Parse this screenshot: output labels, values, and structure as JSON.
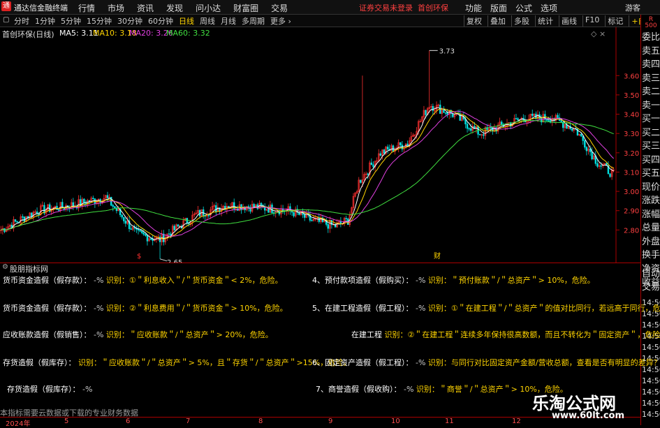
{
  "titlebar": {
    "app_name": "通达信金融终端",
    "menu": [
      "行情",
      "市场",
      "资讯",
      "发现",
      "问小达",
      "财富圈",
      "交易"
    ],
    "notice": "证券交易未登录",
    "stock": "首创环保",
    "right_menu": [
      "功能",
      "版面",
      "公式",
      "选项"
    ],
    "user": "游客"
  },
  "periods": [
    {
      "label": "分时"
    },
    {
      "label": "1分钟"
    },
    {
      "label": "5分钟"
    },
    {
      "label": "15分钟"
    },
    {
      "label": "30分钟"
    },
    {
      "label": "60分钟"
    },
    {
      "label": "日线",
      "active": true
    },
    {
      "label": "周线"
    },
    {
      "label": "月线"
    },
    {
      "label": "多周期"
    },
    {
      "label": "更多 ›"
    }
  ],
  "tools": [
    {
      "label": "复权"
    },
    {
      "label": "叠加"
    },
    {
      "label": "多股"
    },
    {
      "label": "统计"
    },
    {
      "label": "画线"
    },
    {
      "label": "F10"
    },
    {
      "label": "标记"
    },
    {
      "label": "+自选",
      "hl": true
    }
  ],
  "chart_header": {
    "stock_label": "首创环保(日线)",
    "ma": [
      {
        "label": "MA5: 3.11",
        "color": "#ffffff"
      },
      {
        "label": "MA10: 3.18",
        "color": "#ffd400"
      },
      {
        "label": "MA20: 3.26",
        "color": "#e040e0"
      },
      {
        "label": "MA60: 3.32",
        "color": "#40e040"
      }
    ]
  },
  "chart_data": {
    "type": "candlestick",
    "ylim": [
      2.7,
      3.8
    ],
    "y_ticks": [
      "3.60",
      "3.50",
      "3.40",
      "3.30",
      "3.20",
      "3.10",
      "3.00",
      "2.90",
      "2.80"
    ],
    "annotations": {
      "high": "3.73",
      "low": "2.65"
    },
    "x_labels": [
      "2024年",
      "5",
      "6",
      "7",
      "8",
      "9",
      "10",
      "11",
      "12"
    ],
    "markers": [
      "$",
      "财"
    ],
    "colors": {
      "up": "#ff3030",
      "down": "#00e0e0",
      "ma5": "#ffffff",
      "ma10": "#ffd400",
      "ma20": "#e040e0",
      "ma60": "#40e040"
    }
  },
  "indicator": {
    "title": "股朋指标网",
    "rows_left": [
      {
        "label": "货币资金造假（假存款）：",
        "val": "-%",
        "rule": "识别：①＂利息收入＂/＂货币资金＂< 2%，危险。"
      },
      {
        "label": "货币资金造假（假存款）：",
        "val": "-%",
        "rule": "识别：②＂利息费用＂/＂货币资金＂> 10%，危险。"
      },
      {
        "label": "应收账款造假（假销售）：",
        "val": "-%",
        "rule": "识别：＂应收账款＂/＂总资产＂> 20%，危险。"
      },
      {
        "label": "存货造假（假库存）：",
        "val": "",
        "rule": "识别：＂应收账款＂/＂总资产＂> 5%，且＂存货＂/＂总资产＂>15%，危险。"
      },
      {
        "label": "存货造假（假库存）：",
        "val": "-%",
        "rule": ""
      }
    ],
    "rows_right": [
      {
        "label": "4、预付款项造假（假购买）：",
        "val": "-%",
        "rule": "识别：＂预付账款＂/＂总资产＂> 10%，危险。"
      },
      {
        "label": "5、在建工程造假（假工程）：",
        "val": "-%",
        "rule": "识别：①＂在建工程＂/＂总资产＂的值对比同行，若远高于同行，危险。"
      },
      {
        "label": "在建工程",
        "val": "",
        "rule": "识别：②＂在建工程＂连续多年保持很高数额，而且不转化为＂固定资产＂，危险。"
      },
      {
        "label": "6、固定资产造假（假工程）：",
        "val": "-%",
        "rule": "识别：与同行对比固定资产金额/营收总额，查看是否有明显的差异？"
      },
      {
        "label": "7、商誉造假（假收购）：",
        "val": "-%",
        "rule": "识别：＂商誉＂/＂总资产＂> 10%，危险。"
      }
    ],
    "footer": "本指标需要云数据或下载的专业财务数据"
  },
  "side": {
    "r_label": "R",
    "r_num": "500",
    "items": [
      "委比",
      "卖五",
      "卖四",
      "卖三",
      "卖二",
      "卖一",
      "买一",
      "买二",
      "买三",
      "买四",
      "买五",
      "现价",
      "涨跌",
      "涨幅",
      "总量",
      "外盘",
      "换手",
      "净资",
      "收益"
    ],
    "lower": [
      "自动",
      "交易"
    ],
    "times": [
      "14:56",
      "14:56",
      "14:56",
      "14:56",
      "14:56",
      "14:56",
      "14:56",
      "14:56",
      "14:56",
      "14:56",
      "14:56"
    ]
  },
  "watermark": {
    "cn": "乐淘公式网",
    "url": "www.60lt.com"
  }
}
